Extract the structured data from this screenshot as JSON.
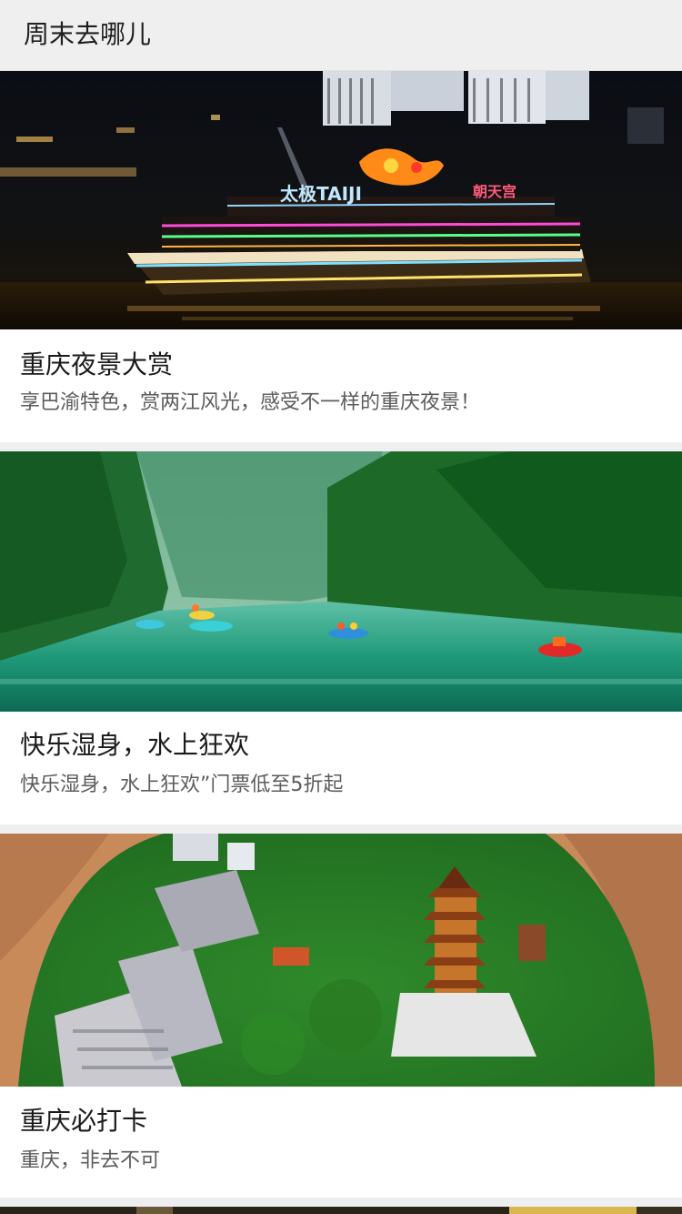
{
  "header": {
    "title": "周末去哪儿"
  },
  "cards": [
    {
      "title": "重庆夜景大赏",
      "description": "享巴渝特色，赏两江风光，感受不一样的重庆夜景！",
      "image_subject": "night-river-cruise-photo",
      "boat_sign": "太极TAIJI",
      "boat_sign_2": "朝天宫"
    },
    {
      "title": "快乐湿身，水上狂欢",
      "description": "快乐湿身，水上狂欢”门票低至5折起",
      "image_subject": "green-river-rafting-photo"
    },
    {
      "title": "重庆必打卡",
      "description": "重庆，非去不可",
      "image_subject": "aerial-city-pagoda-photo"
    }
  ],
  "colors": {
    "page_background": "#efeff1",
    "header_background": "#efefef",
    "title_text": "#1a1a1a",
    "description_text": "#5c5c5c"
  }
}
